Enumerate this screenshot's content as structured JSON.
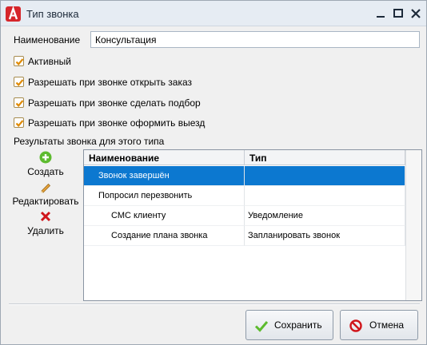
{
  "window": {
    "title": "Тип звонка"
  },
  "form": {
    "name_label": "Наименование",
    "name_value": "Консультация",
    "checkboxes": [
      {
        "label": "Активный",
        "checked": true
      },
      {
        "label": "Разрешать при звонке открыть заказ",
        "checked": true
      },
      {
        "label": "Разрешать при звонке сделать подбор",
        "checked": true
      },
      {
        "label": "Разрешать при звонке оформить выезд",
        "checked": true
      }
    ],
    "results_label": "Результаты звонка для этого типа"
  },
  "side_actions": {
    "create": "Создать",
    "edit": "Редактировать",
    "delete": "Удалить"
  },
  "grid": {
    "columns": [
      "Наименование",
      "Тип"
    ],
    "rows": [
      {
        "name": "Звонок завершён",
        "type": "",
        "selected": true,
        "level": 0
      },
      {
        "name": "Попросил перезвонить",
        "type": "",
        "selected": false,
        "level": 0
      },
      {
        "name": "СМС клиенту",
        "type": "Уведомление",
        "selected": false,
        "level": 1
      },
      {
        "name": "Создание плана звонка",
        "type": "Запланировать звонок",
        "selected": false,
        "level": 1
      }
    ]
  },
  "buttons": {
    "save": "Сохранить",
    "cancel": "Отмена"
  },
  "colors": {
    "selection": "#0c78d0",
    "brand": "#d6262b",
    "check": "#e08a00",
    "ok_icon": "#5dbb2f",
    "cancel_icon": "#d0151b"
  }
}
